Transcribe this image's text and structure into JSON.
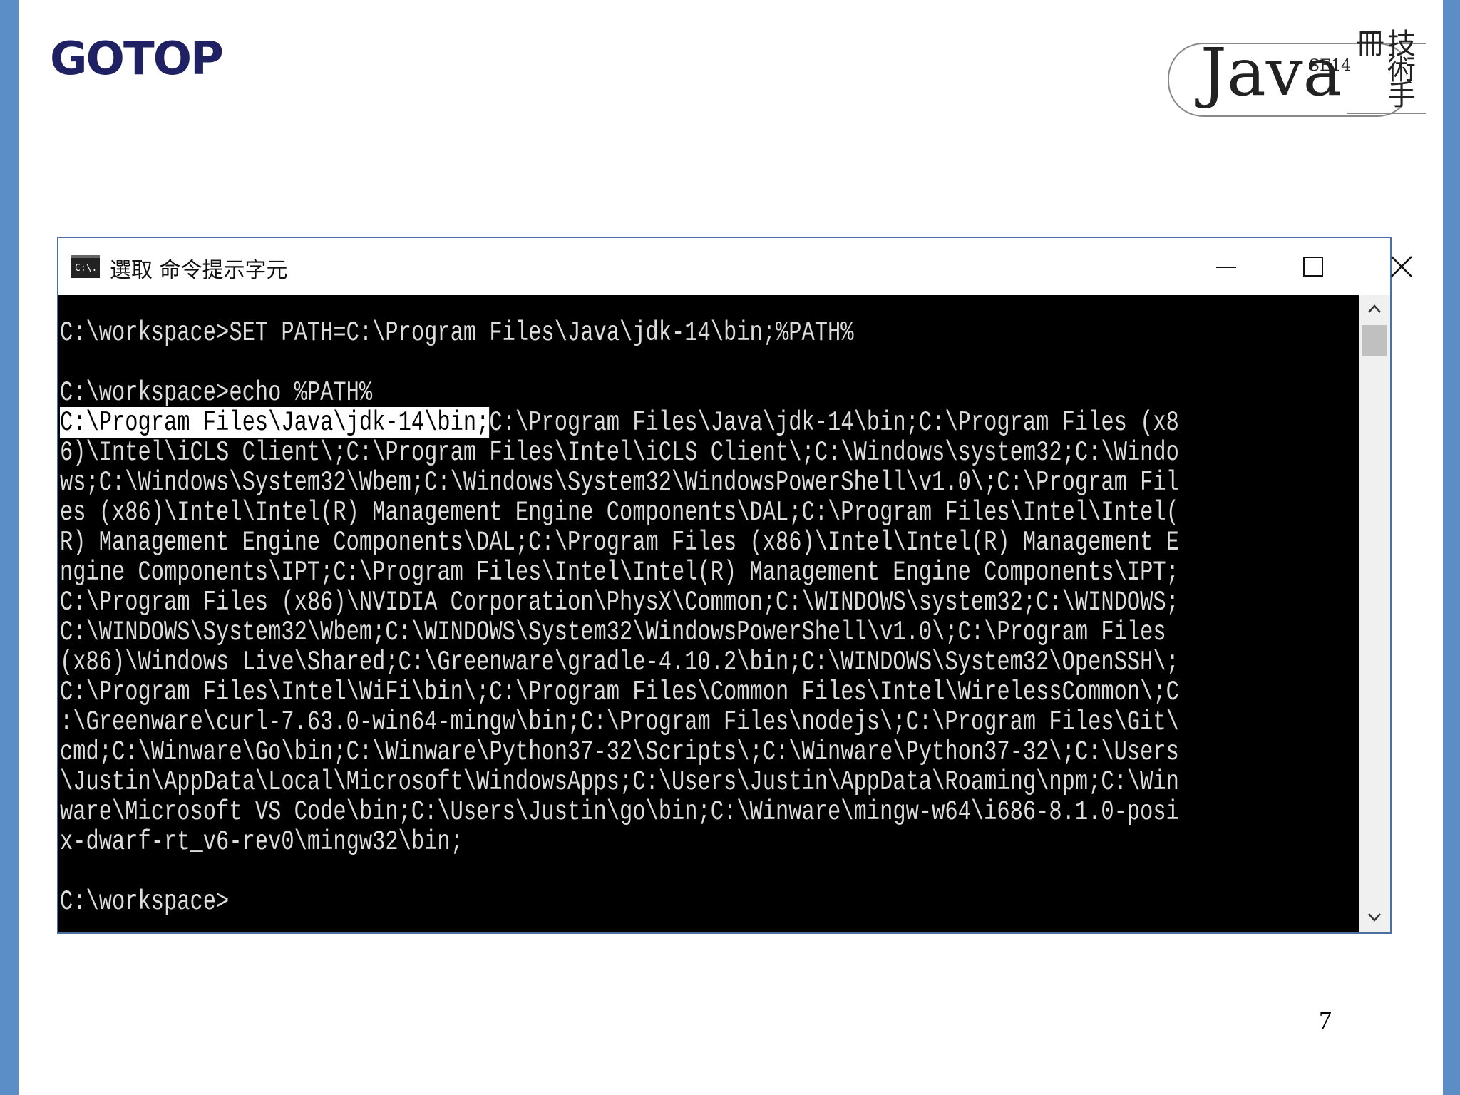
{
  "logo": {
    "text": "GOTOP"
  },
  "badge": {
    "java": "Java",
    "edition": "SE14",
    "subtitle": "技術手冊"
  },
  "window": {
    "title": "選取 命令提示字元",
    "app_icon_text": "C:\\.",
    "controls": {
      "minimize": "minimize",
      "maximize": "maximize",
      "close": "close"
    }
  },
  "console": {
    "lines": [
      "",
      "C:\\workspace>SET PATH=C:\\Program Files\\Java\\jdk-14\\bin;%PATH%",
      "",
      "C:\\workspace>echo %PATH%",
      "",
      "6)\\Intel\\iCLS Client\\;C:\\Program Files\\Intel\\iCLS Client\\;C:\\Windows\\system32;C:\\Windo",
      "ws;C:\\Windows\\System32\\Wbem;C:\\Windows\\System32\\WindowsPowerShell\\v1.0\\;C:\\Program Fil",
      "es (x86)\\Intel\\Intel(R) Management Engine Components\\DAL;C:\\Program Files\\Intel\\Intel(",
      "R) Management Engine Components\\DAL;C:\\Program Files (x86)\\Intel\\Intel(R) Management E",
      "ngine Components\\IPT;C:\\Program Files\\Intel\\Intel(R) Management Engine Components\\IPT;",
      "C:\\Program Files (x86)\\NVIDIA Corporation\\PhysX\\Common;C:\\WINDOWS\\system32;C:\\WINDOWS;",
      "C:\\WINDOWS\\System32\\Wbem;C:\\WINDOWS\\System32\\WindowsPowerShell\\v1.0\\;C:\\Program Files",
      "(x86)\\Windows Live\\Shared;C:\\Greenware\\gradle-4.10.2\\bin;C:\\WINDOWS\\System32\\OpenSSH\\;",
      "C:\\Program Files\\Intel\\WiFi\\bin\\;C:\\Program Files\\Common Files\\Intel\\WirelessCommon\\;C",
      ":\\Greenware\\curl-7.63.0-win64-mingw\\bin;C:\\Program Files\\nodejs\\;C:\\Program Files\\Git\\",
      "cmd;C:\\Winware\\Go\\bin;C:\\Winware\\Python37-32\\Scripts\\;C:\\Winware\\Python37-32\\;C:\\Users",
      "\\Justin\\AppData\\Local\\Microsoft\\WindowsApps;C:\\Users\\Justin\\AppData\\Roaming\\npm;C:\\Win",
      "ware\\Microsoft VS Code\\bin;C:\\Users\\Justin\\go\\bin;C:\\Winware\\mingw-w64\\i686-8.1.0-posi",
      "x-dwarf-rt_v6-rev0\\mingw32\\bin;",
      "",
      "C:\\workspace>"
    ],
    "selected_text": "C:\\Program Files\\Java\\jdk-14\\bin;",
    "selected_line_rest": "C:\\Program Files\\Java\\jdk-14\\bin;C:\\Program Files (x8"
  },
  "page_number": "7",
  "colors": {
    "side_bar": "#5b8ec6",
    "logo": "#1f2163",
    "console_bg": "#000000",
    "console_fg": "#dcdcdc"
  }
}
